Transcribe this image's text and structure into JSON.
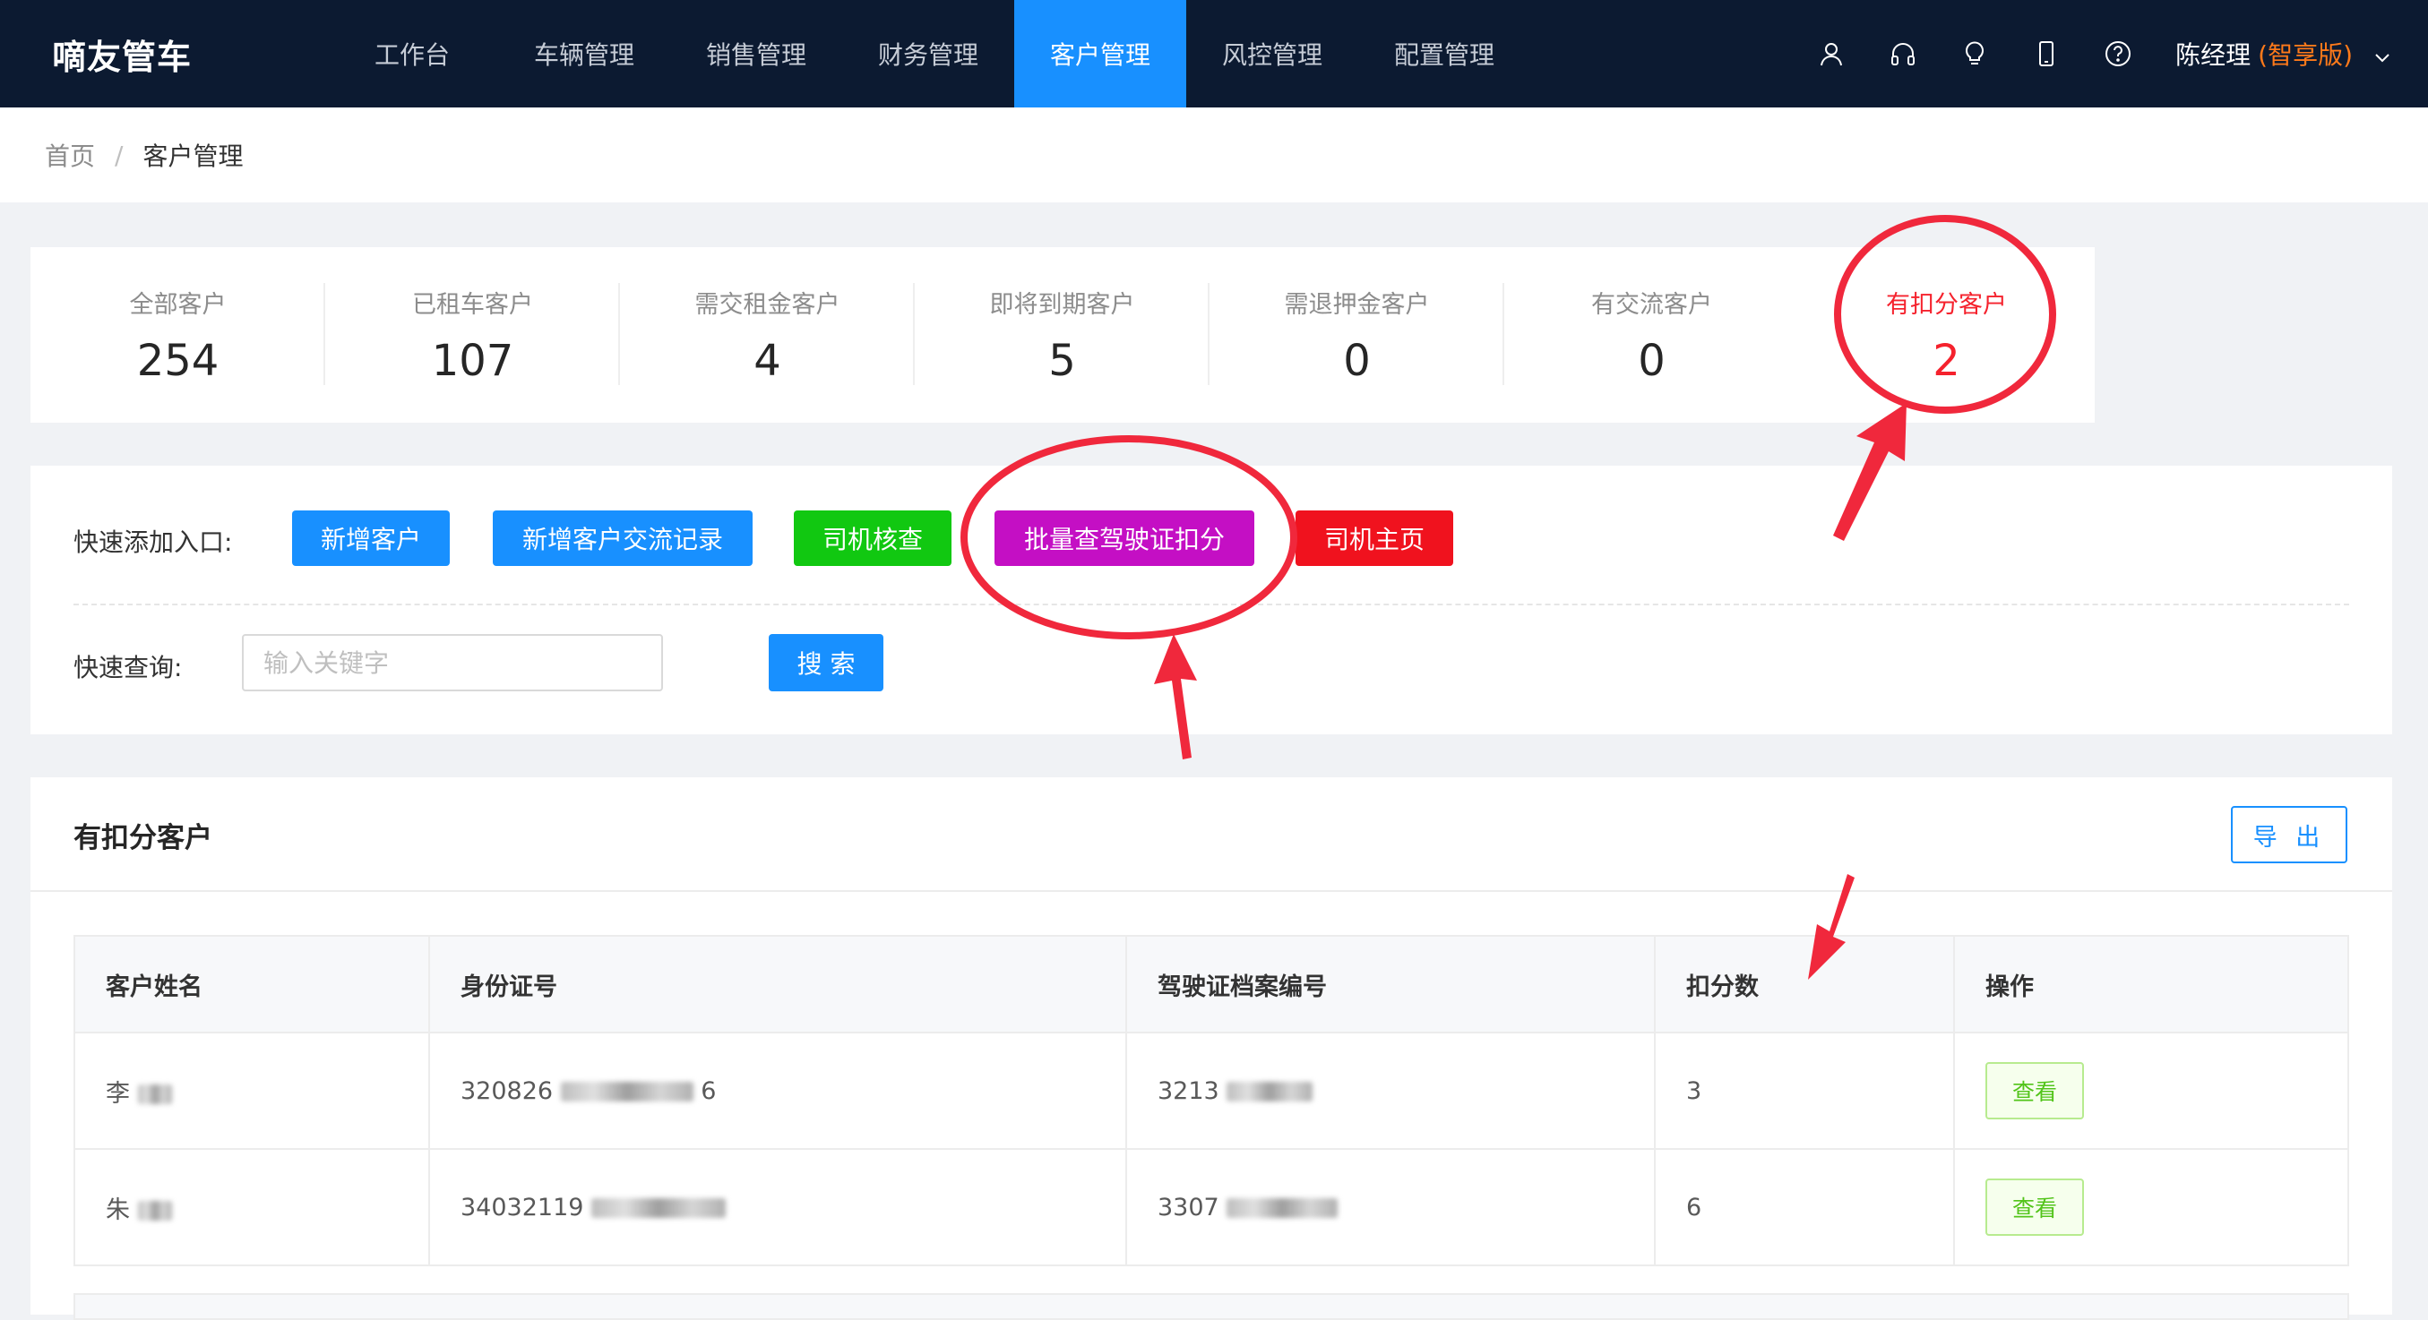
{
  "app": {
    "title": "嘀友管车"
  },
  "nav": {
    "items": [
      "工作台",
      "车辆管理",
      "销售管理",
      "财务管理",
      "客户管理",
      "风控管理",
      "配置管理"
    ],
    "active_index": 4,
    "icons": [
      "user-icon",
      "headset-icon",
      "bulb-icon",
      "mobile-icon",
      "help-icon"
    ],
    "user_name": "陈经理",
    "edition": "(智享版)"
  },
  "breadcrumb": {
    "home": "首页",
    "separator": "/",
    "current": "客户管理"
  },
  "stats": [
    {
      "label": "全部客户",
      "value": "254"
    },
    {
      "label": "已租车客户",
      "value": "107"
    },
    {
      "label": "需交租金客户",
      "value": "4"
    },
    {
      "label": "即将到期客户",
      "value": "5"
    },
    {
      "label": "需退押金客户",
      "value": "0"
    },
    {
      "label": "有交流客户",
      "value": "0"
    },
    {
      "label": "有扣分客户",
      "value": "2"
    }
  ],
  "quick_add": {
    "label": "快速添加入口:",
    "buttons": [
      {
        "label": "新增客户",
        "color": "#1890ff"
      },
      {
        "label": "新增客户交流记录",
        "color": "#1890ff"
      },
      {
        "label": "司机核查",
        "color": "#11c811"
      },
      {
        "label": "批量查驾驶证扣分",
        "color": "#c40fc4"
      },
      {
        "label": "司机主页",
        "color": "#f0121e"
      }
    ]
  },
  "quick_search": {
    "label": "快速查询:",
    "placeholder": "输入关键字",
    "value": "",
    "button_label": "搜 索"
  },
  "table": {
    "title": "有扣分客户",
    "export_label": "导 出",
    "columns": [
      "客户姓名",
      "身份证号",
      "驾驶证档案编号",
      "扣分数",
      "操作"
    ],
    "rows": [
      {
        "name": "李",
        "id_number": "320826",
        "id_tail": "6",
        "license_no": "3213",
        "points": "3",
        "action": "查看"
      },
      {
        "name": "朱",
        "id_number": "34032119",
        "id_tail": "",
        "license_no": "3307",
        "points": "6",
        "action": "查看"
      }
    ]
  },
  "colors": {
    "nav_bg": "#0c1a31",
    "accent": "#1890ff",
    "alert": "#f5222d",
    "annotation": "#f0283c"
  }
}
